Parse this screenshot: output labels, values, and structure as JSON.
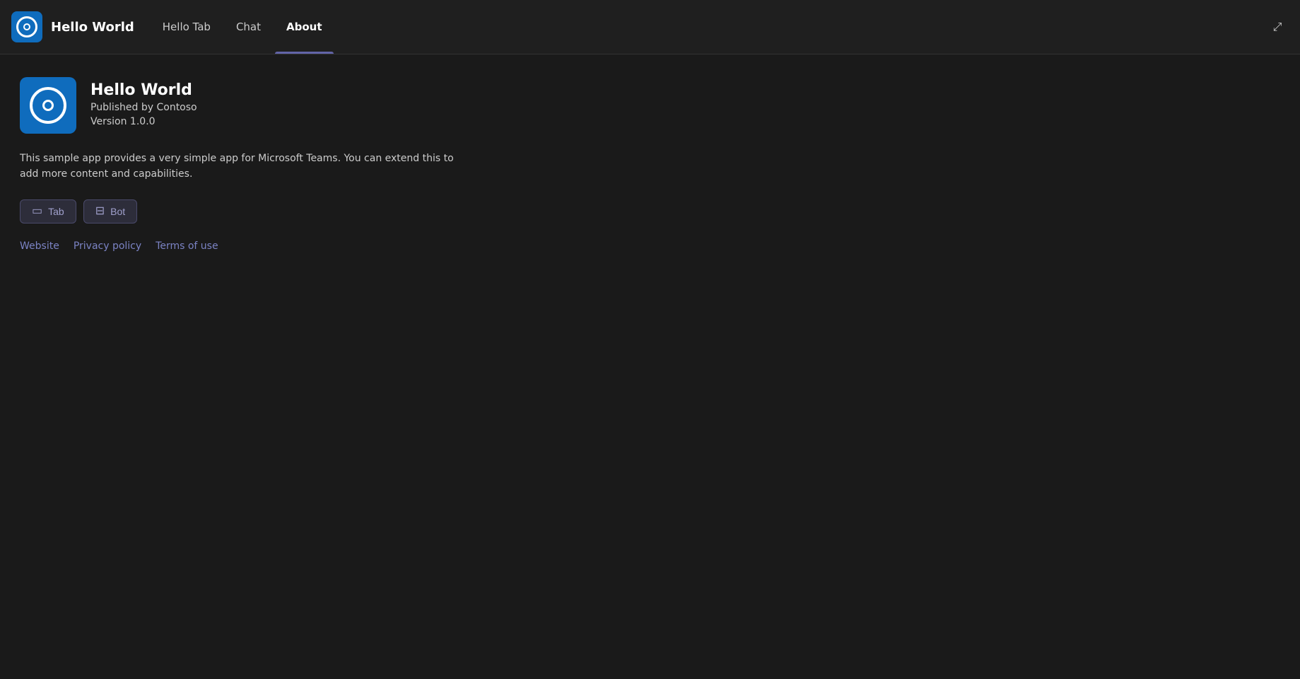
{
  "header": {
    "app_title": "Hello World",
    "tabs": [
      {
        "id": "hello-tab",
        "label": "Hello Tab",
        "active": false
      },
      {
        "id": "chat",
        "label": "Chat",
        "active": false
      },
      {
        "id": "about",
        "label": "About",
        "active": true
      }
    ],
    "expand_icon": "⤢"
  },
  "main": {
    "app_name": "Hello World",
    "app_publisher": "Published by Contoso",
    "app_version": "Version 1.0.0",
    "app_description": "This sample app provides a very simple app for Microsoft Teams. You can extend this to add more content and capabilities.",
    "capabilities": [
      {
        "id": "tab",
        "label": "Tab",
        "icon": "▭"
      },
      {
        "id": "bot",
        "label": "Bot",
        "icon": "⊟"
      }
    ],
    "links": [
      {
        "id": "website",
        "label": "Website"
      },
      {
        "id": "privacy-policy",
        "label": "Privacy policy"
      },
      {
        "id": "terms-of-use",
        "label": "Terms of use"
      }
    ]
  }
}
